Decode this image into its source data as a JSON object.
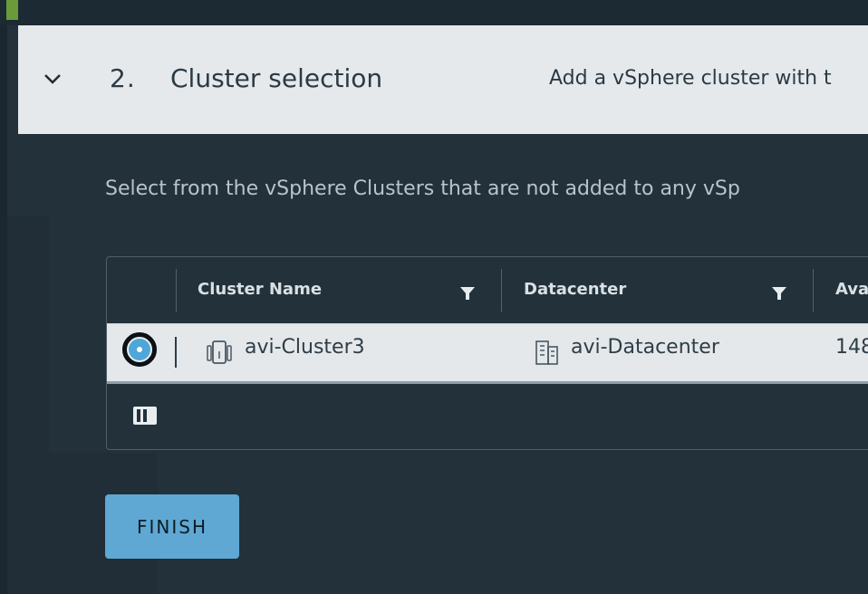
{
  "step": {
    "number": "2.",
    "title": "Cluster selection",
    "description": "Add a vSphere cluster with t"
  },
  "instruction": "Select from the vSphere Clusters that are not added to any vSp",
  "table": {
    "columns": [
      "Cluster Name",
      "Datacenter",
      "Ava"
    ],
    "rows": [
      {
        "selected": true,
        "cluster_name": "avi-Cluster3",
        "datacenter": "avi-Datacenter",
        "available": "148"
      }
    ]
  },
  "actions": {
    "finish_label": "FINISH"
  },
  "colors": {
    "header_bg": "#e5e9ec",
    "page_bg": "#23313a",
    "accent": "#5fa8d3",
    "radio_selected": "#4ea7d8"
  }
}
